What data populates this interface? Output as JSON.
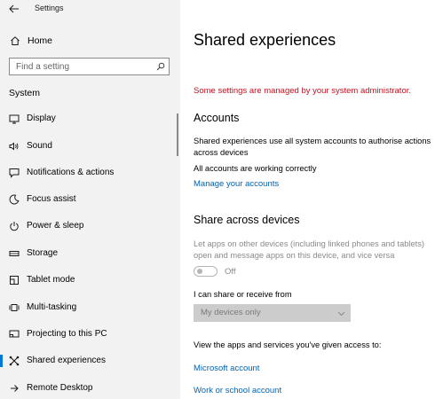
{
  "window": {
    "title": "Settings"
  },
  "sidebar": {
    "home_label": "Home",
    "search_placeholder": "Find a setting",
    "section_title": "System",
    "items": [
      {
        "label": "Display",
        "icon": "display-icon"
      },
      {
        "label": "Sound",
        "icon": "sound-icon"
      },
      {
        "label": "Notifications & actions",
        "icon": "notifications-icon"
      },
      {
        "label": "Focus assist",
        "icon": "focus-assist-icon"
      },
      {
        "label": "Power & sleep",
        "icon": "power-icon"
      },
      {
        "label": "Storage",
        "icon": "storage-icon"
      },
      {
        "label": "Tablet mode",
        "icon": "tablet-mode-icon"
      },
      {
        "label": "Multi-tasking",
        "icon": "multitasking-icon"
      },
      {
        "label": "Projecting to this PC",
        "icon": "projecting-icon"
      },
      {
        "label": "Shared experiences",
        "icon": "shared-experiences-icon",
        "active": true
      },
      {
        "label": "Remote Desktop",
        "icon": "remote-desktop-icon"
      }
    ]
  },
  "main": {
    "title": "Shared experiences",
    "admin_warning": "Some settings are managed by your system administrator.",
    "accounts": {
      "heading": "Accounts",
      "description": "Shared experiences use all system accounts to authorise actions across devices",
      "status": "All accounts are working correctly",
      "manage_link": "Manage your accounts"
    },
    "share_across": {
      "heading": "Share across devices",
      "description": "Let apps on other devices (including linked phones and tablets) open and message apps on this device, and vice versa",
      "toggle_state": "Off",
      "share_label": "I can share or receive from",
      "dropdown_value": "My devices only"
    },
    "access": {
      "label": "View the apps and services you've given access to:",
      "microsoft_account_link": "Microsoft account",
      "work_school_link": "Work or school account"
    }
  },
  "colors": {
    "accent": "#0078d7",
    "link": "#0063b1",
    "warning": "#c50f1f",
    "sidebar_bg": "#f2f2f2",
    "disabled": "#8a8a8a"
  }
}
